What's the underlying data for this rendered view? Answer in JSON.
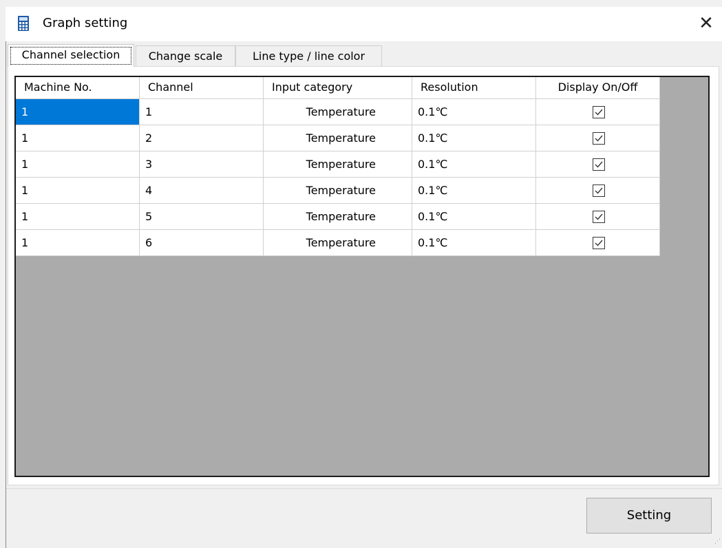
{
  "window": {
    "title": "Graph setting",
    "close_glyph": "✕",
    "icon": "calculator-icon"
  },
  "tabs": [
    {
      "label": "Channel selection",
      "active": true
    },
    {
      "label": "Change scale",
      "active": false
    },
    {
      "label": "Line type / line color",
      "active": false
    }
  ],
  "table": {
    "columns": [
      "Machine No.",
      "Channel",
      "Input category",
      "Resolution",
      "Display On/Off"
    ],
    "rows": [
      {
        "machine": "1",
        "channel": "1",
        "category": "Temperature",
        "resolution": "0.1℃",
        "display": true
      },
      {
        "machine": "1",
        "channel": "2",
        "category": "Temperature",
        "resolution": "0.1℃",
        "display": true
      },
      {
        "machine": "1",
        "channel": "3",
        "category": "Temperature",
        "resolution": "0.1℃",
        "display": true
      },
      {
        "machine": "1",
        "channel": "4",
        "category": "Temperature",
        "resolution": "0.1℃",
        "display": true
      },
      {
        "machine": "1",
        "channel": "5",
        "category": "Temperature",
        "resolution": "0.1℃",
        "display": true
      },
      {
        "machine": "1",
        "channel": "6",
        "category": "Temperature",
        "resolution": "0.1℃",
        "display": true
      }
    ],
    "selected_cell": "machine-row-1"
  },
  "footer": {
    "setting_label": "Setting"
  },
  "colors": {
    "selection": "#0078d7",
    "grid_background": "#ababab",
    "window_background": "#f0f0f0"
  }
}
